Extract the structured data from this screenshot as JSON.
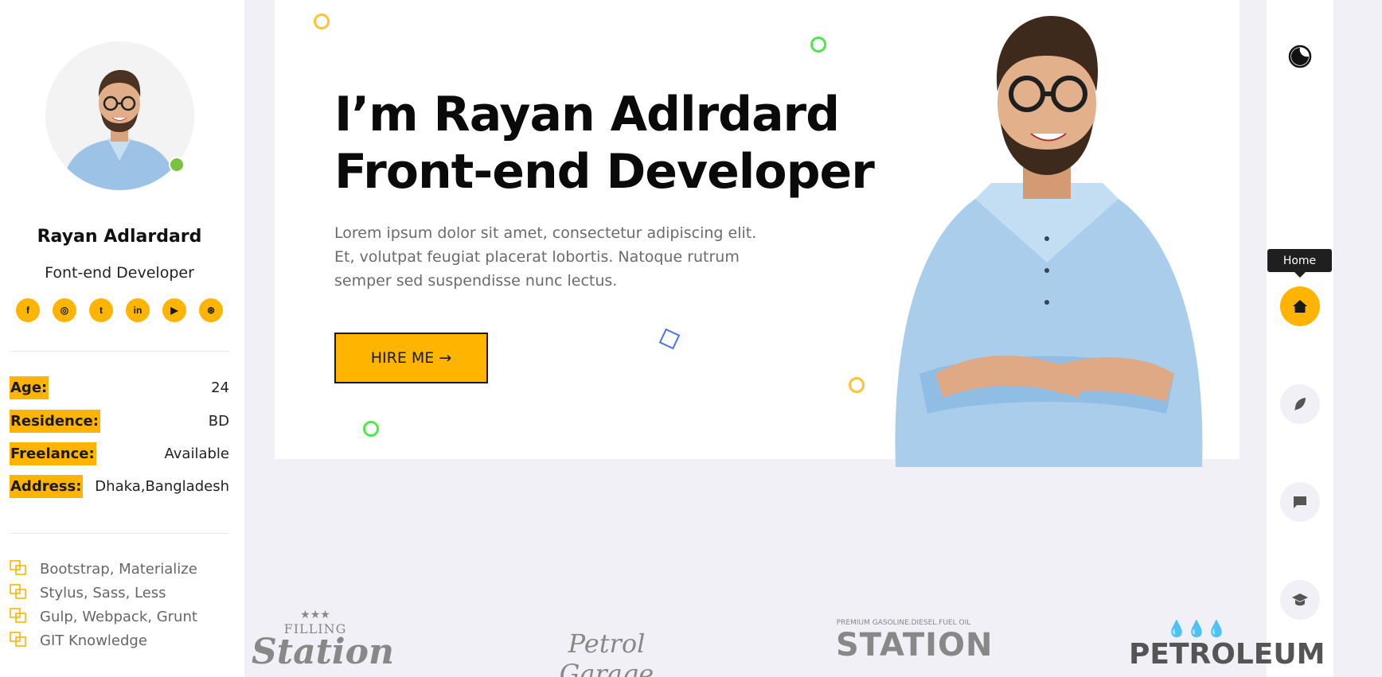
{
  "profile": {
    "name": "Rayan Adlardard",
    "role": "Font-end Developer",
    "socials": [
      {
        "icon": "facebook-icon",
        "glyph": "f"
      },
      {
        "icon": "instagram-icon",
        "glyph": "◎"
      },
      {
        "icon": "twitter-icon",
        "glyph": "t"
      },
      {
        "icon": "linkedin-icon",
        "glyph": "in"
      },
      {
        "icon": "youtube-icon",
        "glyph": "▶"
      },
      {
        "icon": "dribbble-icon",
        "glyph": "⊛"
      }
    ],
    "info": {
      "age_label": "Age:",
      "age": "24",
      "residence_label": "Residence:",
      "residence": "BD",
      "freelance_label": "Freelance:",
      "freelance": "Available",
      "address_label": "Address:",
      "address": "Dhaka,Bangladesh"
    },
    "skills": [
      "Bootstrap, Materialize",
      "Stylus, Sass, Less",
      "Gulp, Webpack, Grunt",
      "GIT Knowledge"
    ]
  },
  "hero": {
    "title_line1": "I’m Rayan Adlrdard",
    "title_line2": "Front-end Developer",
    "description": "Lorem ipsum dolor sit amet, consectetur adipiscing elit. Et, volutpat feugiat placerat lobortis. Natoque rutrum semper sed suspendisse nunc lectus.",
    "cta_label": "HIRE ME",
    "cta_arrow": "→"
  },
  "nav": {
    "tooltip": "Home",
    "items": [
      "theme-toggle-icon",
      "home-icon",
      "feather-icon",
      "chat-icon",
      "graduation-cap-icon"
    ]
  },
  "logos": {
    "filling_top": "FILLING",
    "filling_main": "Station",
    "petrol": "Petrol Garage",
    "station_arc": "PREMIUM GASOLINE.DIESEL.FUEL OIL",
    "station_main": "STATION",
    "petroleum": "PETROLEUM"
  },
  "colors": {
    "accent": "#ffb400",
    "dark": "#1a1a1a",
    "bg": "#f0f0f6",
    "status_online": "#7cc242",
    "shape_yellow": "#ffc334",
    "shape_green": "#4ce84c",
    "shape_blue": "#4a73f0"
  }
}
